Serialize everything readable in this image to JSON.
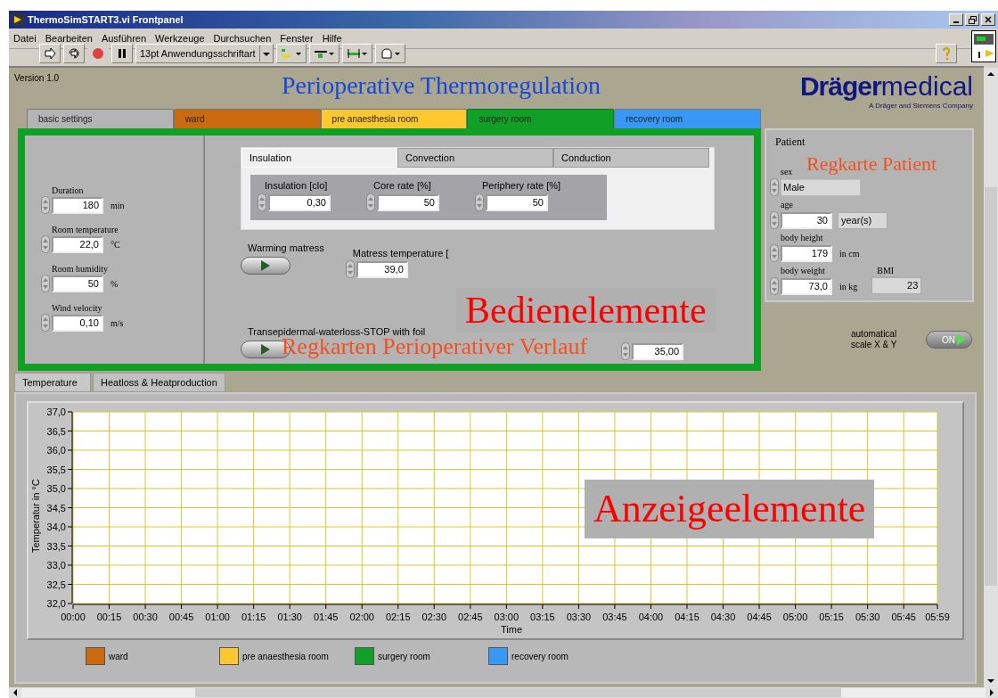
{
  "window": {
    "title": "ThermoSimSTART3.vi Frontpanel"
  },
  "menu": [
    "Datei",
    "Bearbeiten",
    "Ausführen",
    "Werkzeuge",
    "Durchsuchen",
    "Fenster",
    "Hilfe"
  ],
  "toolbar": {
    "font": "13pt Anwendungsschriftart"
  },
  "version": "Version 1.0",
  "title": "Perioperative Thermoregulation",
  "logo": {
    "brand": "Dräger",
    "suffix": "medical",
    "tagline": "A Dräger and Siemens Company"
  },
  "room_tabs": [
    {
      "label": "basic settings",
      "color": "#b4b4b4",
      "selected": false
    },
    {
      "label": "ward",
      "color": "#cc6a10",
      "selected": false
    },
    {
      "label": "pre anaesthesia room",
      "color": "#fcc830",
      "selected": false
    },
    {
      "label": "surgery room",
      "color": "#10a028",
      "selected": true
    },
    {
      "label": "recovery room",
      "color": "#3898f8",
      "selected": false
    }
  ],
  "basic_fields": [
    {
      "label": "Duration",
      "value": "180",
      "unit": "min"
    },
    {
      "label": "Room temperature",
      "value": "22,0",
      "unit": "°C"
    },
    {
      "label": "Room humidity",
      "value": "50",
      "unit": "%"
    },
    {
      "label": "Wind velocity",
      "value": "0,10",
      "unit": "m/s"
    }
  ],
  "inner_tabs": [
    {
      "label": "Insulation",
      "selected": true
    },
    {
      "label": "Convection",
      "selected": false
    },
    {
      "label": "Conduction",
      "selected": false
    }
  ],
  "insulation_fields": [
    {
      "label": "Insulation [clo]",
      "value": "0,30"
    },
    {
      "label": "Core rate [%]",
      "value": "50"
    },
    {
      "label": "Periphery rate [%]",
      "value": "50"
    }
  ],
  "warming": {
    "label": "Warming matress",
    "on": false
  },
  "matress_temperature": {
    "label": "Matress temperature [",
    "value": "39,0"
  },
  "foil": {
    "label": "Transepidermal-waterloss-STOP with foil",
    "on": false
  },
  "extra_field": {
    "value": "35,00"
  },
  "patient": {
    "title": "Patient",
    "sex": {
      "label": "sex",
      "value": "Male"
    },
    "age": {
      "label": "age",
      "value": "30",
      "unit": "year(s)"
    },
    "height": {
      "label": "body height",
      "value": "179",
      "unit": "in cm"
    },
    "weight": {
      "label": "body weight",
      "value": "73,0",
      "unit": "in kg"
    },
    "bmi": {
      "label": "BMI",
      "value": "23"
    }
  },
  "auto_scale": {
    "label": "automatical scale X & Y",
    "on": true,
    "state_text": "ON"
  },
  "chart_tabs": [
    {
      "label": "Temperature",
      "selected": true
    },
    {
      "label": "Heatloss & Heatproduction",
      "selected": false
    }
  ],
  "chart": {
    "chart_data": {
      "type": "line",
      "grid": true,
      "xlabel": "Time",
      "ylabel": "Temperatur in °C",
      "xlim": [
        0,
        359
      ],
      "ylim": [
        32,
        37
      ],
      "yticks": [
        {
          "value": 32,
          "label": "32,0"
        },
        {
          "value": 32.5,
          "label": "32,5"
        },
        {
          "value": 33,
          "label": "33,0"
        },
        {
          "value": 33.5,
          "label": "33,5"
        },
        {
          "value": 34,
          "label": "34,0"
        },
        {
          "value": 34.5,
          "label": "34,5"
        },
        {
          "value": 35,
          "label": "35,0"
        },
        {
          "value": 35.5,
          "label": "35,5"
        },
        {
          "value": 36,
          "label": "36,0"
        },
        {
          "value": 36.5,
          "label": "36,5"
        },
        {
          "value": 37,
          "label": "37,0"
        }
      ],
      "xticks": [
        {
          "value": 0,
          "label": "00:00"
        },
        {
          "value": 15,
          "label": "00:15"
        },
        {
          "value": 30,
          "label": "00:30"
        },
        {
          "value": 45,
          "label": "00:45"
        },
        {
          "value": 60,
          "label": "01:00"
        },
        {
          "value": 75,
          "label": "01:15"
        },
        {
          "value": 90,
          "label": "01:30"
        },
        {
          "value": 105,
          "label": "01:45"
        },
        {
          "value": 120,
          "label": "02:00"
        },
        {
          "value": 135,
          "label": "02:15"
        },
        {
          "value": 150,
          "label": "02:30"
        },
        {
          "value": 165,
          "label": "02:45"
        },
        {
          "value": 180,
          "label": "03:00"
        },
        {
          "value": 195,
          "label": "03:15"
        },
        {
          "value": 210,
          "label": "03:30"
        },
        {
          "value": 225,
          "label": "03:45"
        },
        {
          "value": 240,
          "label": "04:00"
        },
        {
          "value": 255,
          "label": "04:15"
        },
        {
          "value": 270,
          "label": "04:30"
        },
        {
          "value": 285,
          "label": "04:45"
        },
        {
          "value": 300,
          "label": "05:00"
        },
        {
          "value": 315,
          "label": "05:15"
        },
        {
          "value": 330,
          "label": "05:30"
        },
        {
          "value": 345,
          "label": "05:45"
        },
        {
          "value": 359,
          "label": "05:59"
        }
      ]
    }
  },
  "legend": [
    {
      "label": "ward",
      "color": "#cc6a10"
    },
    {
      "label": "pre anaesthesia room",
      "color": "#fcc830"
    },
    {
      "label": "surgery room",
      "color": "#10a028"
    },
    {
      "label": "recovery room",
      "color": "#3898f8"
    }
  ],
  "annotations": [
    {
      "kind": "boxed",
      "text": "Bedienelemente"
    },
    {
      "kind": "plain",
      "text": "Regkarten Perioperativer Verlauf"
    },
    {
      "kind": "plain",
      "text": "Regkarte Patient"
    },
    {
      "kind": "boxed",
      "text": "Anzeigeelemente"
    }
  ]
}
